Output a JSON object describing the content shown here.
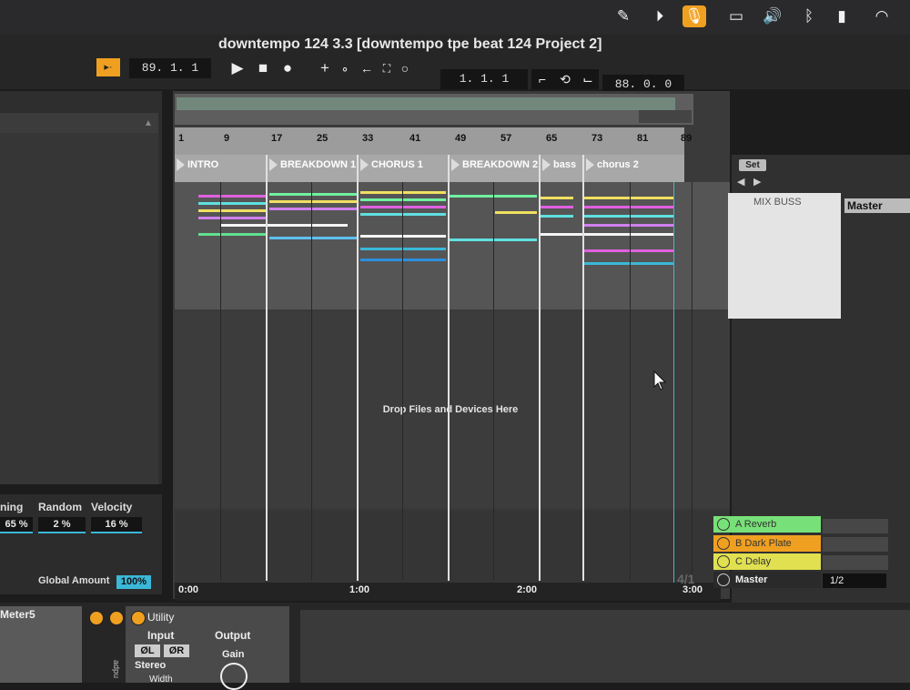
{
  "window_title": "downtempo 124 3.3  [downtempo tpe beat 124 Project 2]",
  "colors": {
    "accent": "#f0a020",
    "cyan": "#3bb8d8",
    "green_return": "#78e078",
    "yellow_return": "#e0e050"
  },
  "menubar_icons": [
    "scribble-icon",
    "play-circle-icon",
    "microphone-icon",
    "display-icon",
    "volume-icon",
    "bluetooth-icon",
    "battery-icon",
    "wifi-icon"
  ],
  "transport": {
    "position_left": "89.  1.  1",
    "arrangement_position": "1.  1.  1",
    "loop_length": "88.  0.  0"
  },
  "ruler": {
    "bars": [
      "1",
      "9",
      "17",
      "25",
      "33",
      "41",
      "49",
      "57",
      "65",
      "73",
      "81",
      "89"
    ]
  },
  "locators": [
    "INTRO",
    "BREAKDOWN 1",
    "CHORUS 1",
    "BREAKDOWN 2",
    "bass",
    "chorus 2"
  ],
  "drop_text": "Drop Files and Devices Here",
  "timeline": [
    "0:00",
    "1:00",
    "2:00",
    "3:00"
  ],
  "time_signature": "4/1",
  "groove": {
    "headers": [
      "ning",
      "Random",
      "Velocity"
    ],
    "values": [
      "65 %",
      "2 %",
      "16 %"
    ],
    "global_amount_label": "Global Amount",
    "global_amount_value": "100%"
  },
  "session": {
    "set_label": "Set",
    "mix_buss": "MIX BUSS",
    "output_select": "Master"
  },
  "returns": [
    {
      "label": "A Reverb"
    },
    {
      "label": "B Dark Plate"
    },
    {
      "label": "C Delay"
    },
    {
      "label": "Master"
    }
  ],
  "master_ratio": "1/2",
  "devices": {
    "meter_title": "Meter5",
    "utility_title": "Utility",
    "input_label": "Input",
    "output_label": "Output",
    "phase_left": "ØL",
    "phase_right": "ØR",
    "channel_mode": "Stereo",
    "gain_label": "Gain",
    "width_label": "Width",
    "side_label": "adpu"
  }
}
